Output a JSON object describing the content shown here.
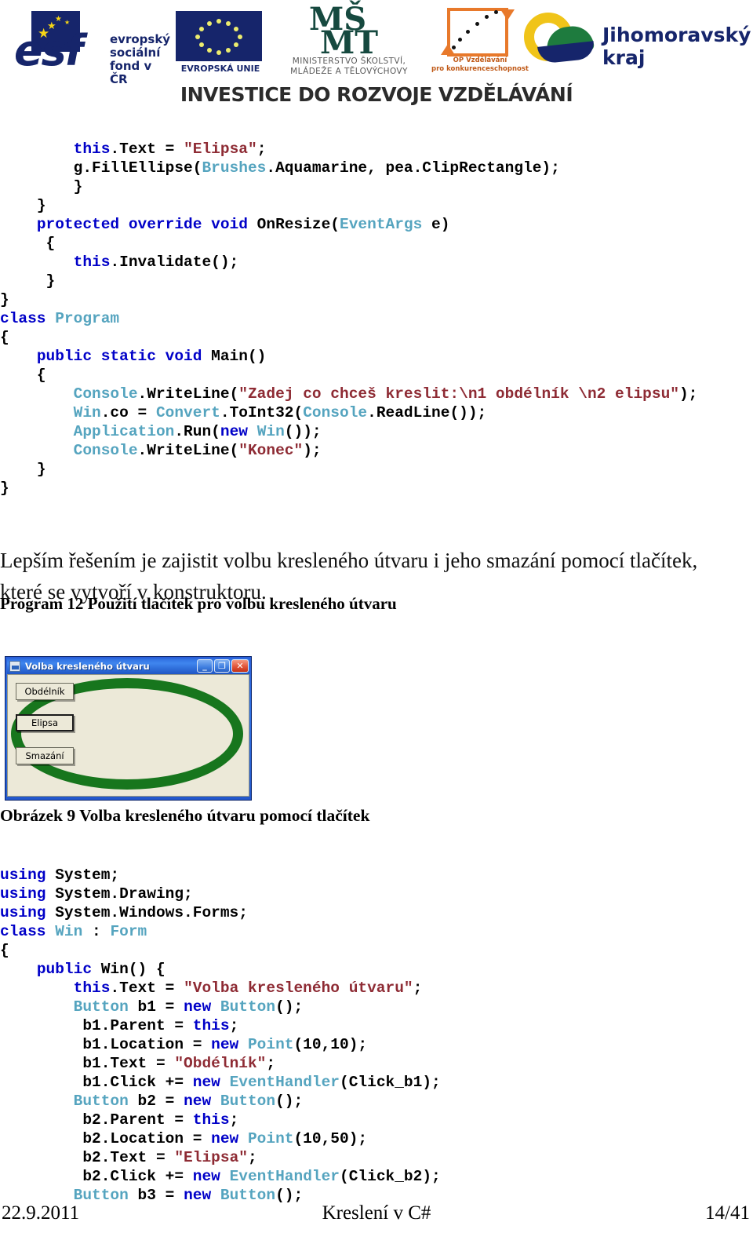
{
  "header": {
    "esf": {
      "wordmark": "esf",
      "tagline_line1": "evropský",
      "tagline_line2": "sociální",
      "tagline_line3": "fond v ČR"
    },
    "eu": {
      "label": "EVROPSKÁ UNIE"
    },
    "msmt": {
      "mark_line1": "MŠ",
      "mark_line2": "MT",
      "label_line1": "MINISTERSTVO ŠKOLSTVÍ,",
      "label_line2": "MLÁDEŽE A TĚLOVÝCHOVY"
    },
    "op": {
      "label_line1": "OP Vzdělávání",
      "label_line2": "pro konkurenceschopnost"
    },
    "jmk": {
      "label": "Jihomoravský kraj"
    },
    "slogan": "INVESTICE DO ROZVOJE VZDĚLÁVÁNÍ"
  },
  "code_block_1": {
    "lines": [
      [
        {
          "t": "        ",
          "c": "pln"
        },
        {
          "t": "this",
          "c": "kw"
        },
        {
          "t": ".Text = ",
          "c": "pln"
        },
        {
          "t": "\"Elipsa\"",
          "c": "str"
        },
        {
          "t": ";",
          "c": "pln"
        }
      ],
      [
        {
          "t": "        g.FillEllipse(",
          "c": "pln"
        },
        {
          "t": "Brushes",
          "c": "typ"
        },
        {
          "t": ".Aquamarine, pea.ClipRectangle);",
          "c": "pln"
        }
      ],
      [
        {
          "t": "        }",
          "c": "pln"
        }
      ],
      [
        {
          "t": "    }",
          "c": "pln"
        }
      ],
      [
        {
          "t": "    ",
          "c": "pln"
        },
        {
          "t": "protected override void ",
          "c": "kw"
        },
        {
          "t": "OnResize(",
          "c": "pln"
        },
        {
          "t": "EventArgs",
          "c": "typ"
        },
        {
          "t": " e)",
          "c": "pln"
        }
      ],
      [
        {
          "t": "     {",
          "c": "pln"
        }
      ],
      [
        {
          "t": "        ",
          "c": "pln"
        },
        {
          "t": "this",
          "c": "kw"
        },
        {
          "t": ".Invalidate();",
          "c": "pln"
        }
      ],
      [
        {
          "t": "     }",
          "c": "pln"
        }
      ],
      [
        {
          "t": "}",
          "c": "pln"
        }
      ],
      [
        {
          "t": "class ",
          "c": "kw"
        },
        {
          "t": "Program",
          "c": "typ"
        }
      ],
      [
        {
          "t": "{",
          "c": "pln"
        }
      ],
      [
        {
          "t": "    ",
          "c": "pln"
        },
        {
          "t": "public static void ",
          "c": "kw"
        },
        {
          "t": "Main()",
          "c": "pln"
        }
      ],
      [
        {
          "t": "    {",
          "c": "pln"
        }
      ],
      [
        {
          "t": "        ",
          "c": "pln"
        },
        {
          "t": "Console",
          "c": "typ"
        },
        {
          "t": ".WriteLine(",
          "c": "pln"
        },
        {
          "t": "\"Zadej co chceš kreslit:\\n1 obdélník \\n2 elipsu\"",
          "c": "str"
        },
        {
          "t": ");",
          "c": "pln"
        }
      ],
      [
        {
          "t": "        ",
          "c": "pln"
        },
        {
          "t": "Win",
          "c": "typ"
        },
        {
          "t": ".co = ",
          "c": "pln"
        },
        {
          "t": "Convert",
          "c": "typ"
        },
        {
          "t": ".ToInt32(",
          "c": "pln"
        },
        {
          "t": "Console",
          "c": "typ"
        },
        {
          "t": ".ReadLine());",
          "c": "pln"
        }
      ],
      [
        {
          "t": "        ",
          "c": "pln"
        },
        {
          "t": "Application",
          "c": "typ"
        },
        {
          "t": ".Run(",
          "c": "pln"
        },
        {
          "t": "new ",
          "c": "kw"
        },
        {
          "t": "Win",
          "c": "typ"
        },
        {
          "t": "());",
          "c": "pln"
        }
      ],
      [
        {
          "t": "        ",
          "c": "pln"
        },
        {
          "t": "Console",
          "c": "typ"
        },
        {
          "t": ".WriteLine(",
          "c": "pln"
        },
        {
          "t": "\"Konec\"",
          "c": "str"
        },
        {
          "t": ");",
          "c": "pln"
        }
      ],
      [
        {
          "t": "    }",
          "c": "pln"
        }
      ],
      [
        {
          "t": "}",
          "c": "pln"
        }
      ]
    ]
  },
  "paragraph_1": "Lepším řešením je zajistit volbu kresleného útvaru i jeho smazání pomocí tlačítek, které se vytvoří v konstruktoru.",
  "program_caption": "Program  12 Použití tlačítek pro volbu kresleného útvaru",
  "figure_caption": "Obrázek 9 Volba kresleného útvaru pomocí tlačítek",
  "winform": {
    "title": "Volba kresleného útvaru",
    "app_icon": "window-app-icon",
    "minimize_glyph": "_",
    "maximize_glyph": "❐",
    "close_glyph": "✕",
    "buttons": [
      {
        "label": "Obdélník"
      },
      {
        "label": "Elipsa"
      },
      {
        "label": "Smazání"
      }
    ],
    "ellipse_color": "#17761d",
    "client_color": "#ece9d8",
    "titlebar_color": "#2f6fe0"
  },
  "code_block_2": {
    "lines": [
      [
        {
          "t": "using ",
          "c": "kw"
        },
        {
          "t": "System;",
          "c": "pln"
        }
      ],
      [
        {
          "t": "using ",
          "c": "kw"
        },
        {
          "t": "System.Drawing;",
          "c": "pln"
        }
      ],
      [
        {
          "t": "using ",
          "c": "kw"
        },
        {
          "t": "System.Windows.Forms;",
          "c": "pln"
        }
      ],
      [
        {
          "t": "class ",
          "c": "kw"
        },
        {
          "t": "Win",
          "c": "typ"
        },
        {
          "t": " : ",
          "c": "pln"
        },
        {
          "t": "Form",
          "c": "typ"
        }
      ],
      [
        {
          "t": "{",
          "c": "pln"
        }
      ],
      [
        {
          "t": "    ",
          "c": "pln"
        },
        {
          "t": "public ",
          "c": "kw"
        },
        {
          "t": "Win() {",
          "c": "pln"
        }
      ],
      [
        {
          "t": "        ",
          "c": "pln"
        },
        {
          "t": "this",
          "c": "kw"
        },
        {
          "t": ".Text = ",
          "c": "pln"
        },
        {
          "t": "\"Volba kresleného útvaru\"",
          "c": "str"
        },
        {
          "t": ";",
          "c": "pln"
        }
      ],
      [
        {
          "t": "        ",
          "c": "pln"
        },
        {
          "t": "Button",
          "c": "typ"
        },
        {
          "t": " b1 = ",
          "c": "pln"
        },
        {
          "t": "new ",
          "c": "kw"
        },
        {
          "t": "Button",
          "c": "typ"
        },
        {
          "t": "();",
          "c": "pln"
        }
      ],
      [
        {
          "t": "         b1.Parent = ",
          "c": "pln"
        },
        {
          "t": "this",
          "c": "kw"
        },
        {
          "t": ";",
          "c": "pln"
        }
      ],
      [
        {
          "t": "         b1.Location = ",
          "c": "pln"
        },
        {
          "t": "new ",
          "c": "kw"
        },
        {
          "t": "Point",
          "c": "typ"
        },
        {
          "t": "(10,10);",
          "c": "pln"
        }
      ],
      [
        {
          "t": "         b1.Text = ",
          "c": "pln"
        },
        {
          "t": "\"Obdélník\"",
          "c": "str"
        },
        {
          "t": ";",
          "c": "pln"
        }
      ],
      [
        {
          "t": "         b1.Click += ",
          "c": "pln"
        },
        {
          "t": "new ",
          "c": "kw"
        },
        {
          "t": "EventHandler",
          "c": "typ"
        },
        {
          "t": "(Click_b1);",
          "c": "pln"
        }
      ],
      [
        {
          "t": "        ",
          "c": "pln"
        },
        {
          "t": "Button",
          "c": "typ"
        },
        {
          "t": " b2 = ",
          "c": "pln"
        },
        {
          "t": "new ",
          "c": "kw"
        },
        {
          "t": "Button",
          "c": "typ"
        },
        {
          "t": "();",
          "c": "pln"
        }
      ],
      [
        {
          "t": "         b2.Parent = ",
          "c": "pln"
        },
        {
          "t": "this",
          "c": "kw"
        },
        {
          "t": ";",
          "c": "pln"
        }
      ],
      [
        {
          "t": "         b2.Location = ",
          "c": "pln"
        },
        {
          "t": "new ",
          "c": "kw"
        },
        {
          "t": "Point",
          "c": "typ"
        },
        {
          "t": "(10,50);",
          "c": "pln"
        }
      ],
      [
        {
          "t": "         b2.Text = ",
          "c": "pln"
        },
        {
          "t": "\"Elipsa\"",
          "c": "str"
        },
        {
          "t": ";",
          "c": "pln"
        }
      ],
      [
        {
          "t": "         b2.Click += ",
          "c": "pln"
        },
        {
          "t": "new ",
          "c": "kw"
        },
        {
          "t": "EventHandler",
          "c": "typ"
        },
        {
          "t": "(Click_b2);",
          "c": "pln"
        }
      ],
      [
        {
          "t": "        ",
          "c": "pln"
        },
        {
          "t": "Button",
          "c": "typ"
        },
        {
          "t": " b3 = ",
          "c": "pln"
        },
        {
          "t": "new ",
          "c": "kw"
        },
        {
          "t": "Button",
          "c": "typ"
        },
        {
          "t": "();",
          "c": "pln"
        }
      ]
    ]
  },
  "footer": {
    "date": "22.9.2011",
    "title": "Kreslení v C#",
    "page": "14/41"
  }
}
